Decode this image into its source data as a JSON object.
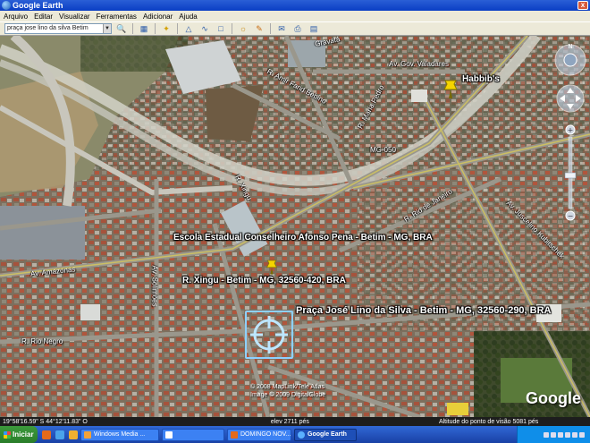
{
  "window": {
    "title": "Google Earth",
    "close_glyph": "x"
  },
  "menu": [
    "Arquivo",
    "Editar",
    "Visualizar",
    "Ferramentas",
    "Adicionar",
    "Ajuda"
  ],
  "toolbar": {
    "search_value": "praça jose lino da silva Betim",
    "buttons": [
      "search-icon",
      "sidebar-icon",
      "placemark-icon",
      "polygon-icon",
      "path-icon",
      "overlay-icon",
      "sky-icon",
      "tour-icon",
      "email-icon",
      "print-icon",
      "maps-icon"
    ]
  },
  "map": {
    "street_labels": [
      {
        "text": "Gravatá"
      },
      {
        "text": "Av. Gov. Valadares"
      },
      {
        "text": "R. Amir Farid Bebino"
      },
      {
        "text": "R. Maria Pedro"
      },
      {
        "text": "MG-050"
      },
      {
        "text": "R. Xingu"
      },
      {
        "text": "R. Rio de Janeiro"
      },
      {
        "text": "Av. Juscelino Kubitschek"
      },
      {
        "text": "Av. Amazonas"
      },
      {
        "text": "Av. Solimões"
      },
      {
        "text": "R. Rio Negro"
      }
    ],
    "places": [
      {
        "text": "Habbib's"
      },
      {
        "text": "Escola Estadual Conselheiro Afonso Pena - Betim - MG, BRA"
      },
      {
        "text": "R. Xingu - Betim - MG, 32560-420, BRA"
      },
      {
        "text": "Praça José Lino da Silva - Betim - MG, 32560-290, BRA"
      }
    ],
    "copyright": [
      "© 2008 MapLink/Tele Atlas",
      "Image © 2009 DigitalGlobe"
    ],
    "logo": "Google",
    "label_color": "#ffffff",
    "pin_color": "#f5d400"
  },
  "status": {
    "coords": "19°58'16.59\" S     44°12'11.83\" O",
    "elev": "elev  2711 pés",
    "eye_alt": "Altitude do ponto de visão    5081 pés"
  },
  "taskbar": {
    "start": "Iniciar",
    "tasks": [
      {
        "label": "Windows Media ...",
        "active": false
      },
      {
        "label": "",
        "active": false
      },
      {
        "label": "DOMINGO NOV...",
        "active": false
      },
      {
        "label": "Google Earth",
        "active": true
      }
    ]
  }
}
